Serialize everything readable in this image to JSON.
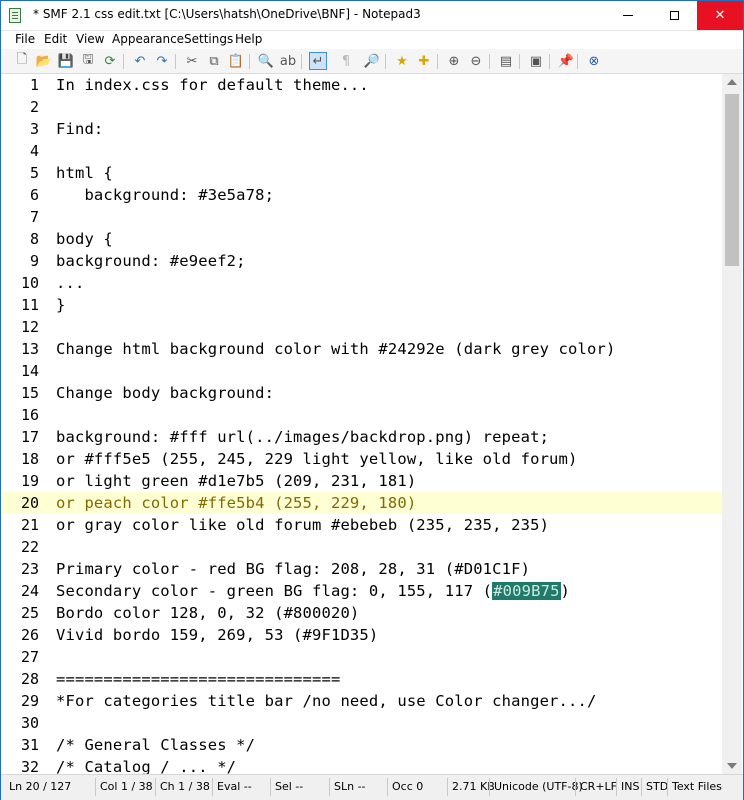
{
  "window": {
    "title": "* SMF 2.1 css edit.txt [C:\\Users\\hatsh\\OneDrive\\BNF] - Notepad3",
    "min_icon": "minimize-icon",
    "max_icon": "maximize-icon",
    "close_glyph": "✕"
  },
  "menu": [
    "File",
    "Edit",
    "View",
    "Appearance",
    "Settings",
    "Help"
  ],
  "toolbar": {
    "icons": [
      "new-file-icon",
      "open-file-icon",
      "save-icon",
      "save-as-icon",
      "reload-icon",
      "undo-icon",
      "redo-icon",
      "cut-icon",
      "copy-icon",
      "paste-icon",
      "find-icon",
      "replace-icon",
      "word-wrap-icon",
      "show-whitespace-icon",
      "zoom-selection-icon",
      "bookmark-icon",
      "add-bookmark-icon",
      "zoom-in-icon",
      "zoom-out-icon",
      "scheme-icon",
      "console-icon",
      "pin-icon",
      "exit-icon"
    ],
    "glyphs": [
      "🗋",
      "📂",
      "💾",
      "🖫",
      "⟳",
      "↶",
      "↷",
      "✂",
      "⧉",
      "📋",
      "🔍",
      "ab",
      "↵",
      "¶",
      "🔎",
      "★",
      "✚",
      "⊕",
      "⊖",
      "▤",
      "▣",
      "📌",
      "⊗"
    ]
  },
  "editor": {
    "current_line": 20,
    "selection_text": "#009B75",
    "lines": [
      {
        "n": "1",
        "t": "In index.css for default theme..."
      },
      {
        "n": "2",
        "t": ""
      },
      {
        "n": "3",
        "t": "Find:"
      },
      {
        "n": "4",
        "t": ""
      },
      {
        "n": "5",
        "t": "html {"
      },
      {
        "n": "6",
        "t": "   background: #3e5a78;"
      },
      {
        "n": "7",
        "t": ""
      },
      {
        "n": "8",
        "t": "body {"
      },
      {
        "n": "9",
        "t": "background: #e9eef2;"
      },
      {
        "n": "10",
        "t": "..."
      },
      {
        "n": "11",
        "t": "}"
      },
      {
        "n": "12",
        "t": ""
      },
      {
        "n": "13",
        "t": "Change html background color with #24292e (dark grey color)"
      },
      {
        "n": "14",
        "t": ""
      },
      {
        "n": "15",
        "t": "Change body background:"
      },
      {
        "n": "16",
        "t": ""
      },
      {
        "n": "17",
        "t": "background: #fff url(../images/backdrop.png) repeat;"
      },
      {
        "n": "18",
        "t": "or #fff5e5 (255, 245, 229 light yellow, like old forum)"
      },
      {
        "n": "19",
        "t": "or light green #d1e7b5 (209, 231, 181)"
      },
      {
        "n": "20",
        "t": "or peach color #ffe5b4 (255, 229, 180)"
      },
      {
        "n": "21",
        "t": "or gray color like old forum #ebebeb (235, 235, 235)"
      },
      {
        "n": "22",
        "t": ""
      },
      {
        "n": "23",
        "t": "Primary color - red BG flag: 208, 28, 31 (#D01C1F)"
      },
      {
        "n": "24",
        "pre": "Secondary color - green BG flag: 0, 155, 117 (",
        "post": ")"
      },
      {
        "n": "25",
        "t": "Bordo color 128, 0, 32 (#800020)"
      },
      {
        "n": "26",
        "t": "Vivid bordo 159, 269, 53 (#9F1D35)"
      },
      {
        "n": "27",
        "t": ""
      },
      {
        "n": "28",
        "t": "=============================="
      },
      {
        "n": "29",
        "t": "*For categories title bar /no need, use Color changer.../"
      },
      {
        "n": "30",
        "t": ""
      },
      {
        "n": "31",
        "t": "/* General Classes */"
      },
      {
        "n": "32",
        "t": "/* Catalog / ... */"
      }
    ]
  },
  "status": [
    {
      "k": "ln",
      "t": "Ln  20 / 127"
    },
    {
      "k": "col",
      "t": "Col  1 / 38"
    },
    {
      "k": "ch",
      "t": "Ch  1 / 38"
    },
    {
      "k": "eval",
      "t": "Eval  --"
    },
    {
      "k": "sel",
      "t": "Sel  --"
    },
    {
      "k": "sln",
      "t": "SLn  --"
    },
    {
      "k": "occ",
      "t": "Occ  0"
    },
    {
      "k": "size",
      "t": "2.71 KB"
    },
    {
      "k": "enc",
      "t": "Unicode (UTF-8)"
    },
    {
      "k": "eol",
      "t": "CR+LF"
    },
    {
      "k": "ins",
      "t": "INS"
    },
    {
      "k": "std",
      "t": "STD"
    },
    {
      "k": "lex",
      "t": "Text Files"
    }
  ]
}
